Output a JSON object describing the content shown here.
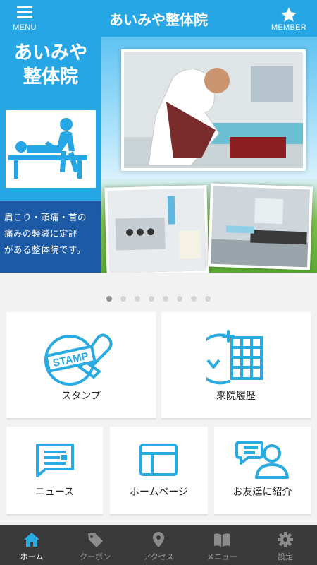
{
  "header": {
    "menu_label": "MENU",
    "title": "あいみや整体院",
    "member_label": "MEMBER"
  },
  "hero": {
    "title_line1": "あいみや",
    "title_line2": "整体院",
    "caption_line1": "肩こり・頭痛・首の",
    "caption_line2": "痛みの軽減に定評",
    "caption_line3": "がある整体院です。"
  },
  "carousel": {
    "total": 8,
    "active_index": 0
  },
  "tiles": {
    "stamp": {
      "label": "スタンプ",
      "icon_text": "STAMP"
    },
    "history": {
      "label": "来院履歴"
    },
    "news": {
      "label": "ニュース"
    },
    "homepage": {
      "label": "ホームページ"
    },
    "invite": {
      "label": "お友達に紹介"
    }
  },
  "tabbar": {
    "items": [
      {
        "label": "ホーム",
        "icon": "home-icon",
        "active": true
      },
      {
        "label": "クーポン",
        "icon": "coupon-tag-icon",
        "active": false
      },
      {
        "label": "アクセス",
        "icon": "map-pin-icon",
        "active": false
      },
      {
        "label": "メニュー",
        "icon": "book-icon",
        "active": false
      },
      {
        "label": "設定",
        "icon": "gear-icon",
        "active": false
      }
    ]
  },
  "colors": {
    "primary": "#26a6e4",
    "hero_panel_dark": "#1d5aa6",
    "tabbar_bg": "#3a3a3a",
    "icon_blue": "#29abe2"
  }
}
